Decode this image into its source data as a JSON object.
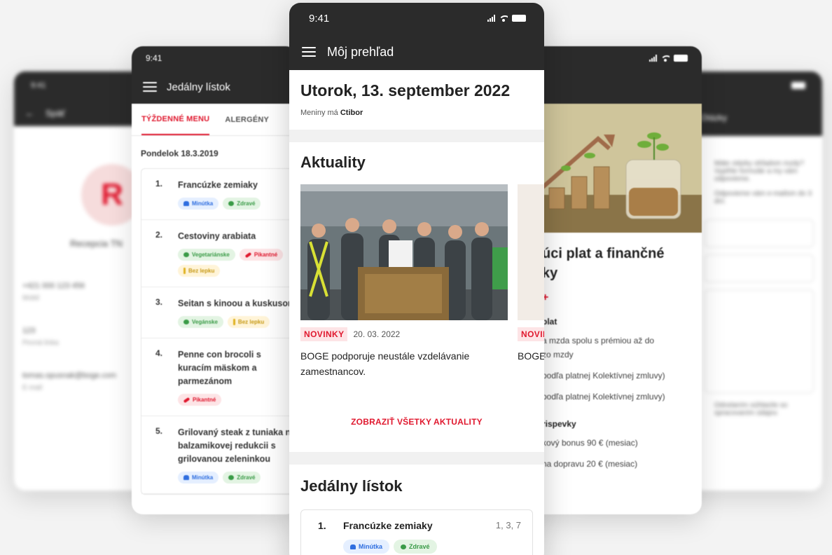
{
  "colors": {
    "accent": "#e0192f",
    "bar": "#2b2b2b"
  },
  "far_left": {
    "status_time": "9:41",
    "back_label": "Späť",
    "avatar_initial": "R",
    "name": "Recepcia TN",
    "fields": [
      {
        "value": "+421 000 123 456",
        "label": "Mobil"
      },
      {
        "value": "123",
        "label": "Pevná linka"
      },
      {
        "value": "tomas.opusnak@boge.com",
        "label": "E-mail"
      }
    ]
  },
  "far_right": {
    "appbar_title": "Otázky",
    "lines": [
      "Máte otázky ohľadom mzdy? Vyplňte formulár a my vám odpovieme.",
      "Odpovieme vám e-mailom do 3 dní."
    ],
    "footer_note": "Odoslaním súhlasíte so spracovaním údajov."
  },
  "menu_phone": {
    "status_time": "9:41",
    "title": "Jedálny lístok",
    "tabs": [
      "TÝŽDENNÉ MENU",
      "ALERGÉNY"
    ],
    "date": "Pondelok 18.3.2019",
    "items": [
      {
        "num": "1.",
        "name": "Francúzke zemiaky",
        "tags": [
          {
            "label": "Minútka",
            "type": "blue"
          },
          {
            "label": "Zdravé",
            "type": "green"
          }
        ]
      },
      {
        "num": "2.",
        "name": "Cestoviny arabiata",
        "tags": [
          {
            "label": "Vegetariánske",
            "type": "green"
          },
          {
            "label": "Pikantné",
            "type": "red"
          },
          {
            "label": "Bez lepku",
            "type": "yellow"
          }
        ]
      },
      {
        "num": "3.",
        "name": "Seitan s kinoou a kuskusom",
        "tags": [
          {
            "label": "Vegánske",
            "type": "green"
          },
          {
            "label": "Bez lepku",
            "type": "yellow"
          }
        ]
      },
      {
        "num": "4.",
        "name": "Penne con brocoli s kuracím mäskom a parmezánom",
        "tags": [
          {
            "label": "Pikantné",
            "type": "red"
          }
        ]
      },
      {
        "num": "5.",
        "name": "Grilovaný steak z tuniaka na balzamikovej redukcii s grilovanou zeleninkou",
        "tags": [
          {
            "label": "Minútka",
            "type": "blue"
          },
          {
            "label": "Zdravé",
            "type": "green"
          }
        ]
      }
    ]
  },
  "finance_phone": {
    "title_fragment": "úci plat a finančné",
    "title_fragment2": "ky",
    "plus": "+",
    "subheading1": "plat",
    "lines1": [
      "a mzda spolu s prémiou až do",
      " zo mzdy",
      "podľa platnej Kolektívnej zmluvy)",
      "podľa platnej Kolektívnej zmluvy)"
    ],
    "subheading2": "rispevky",
    "lines2": [
      "kový bonus 90 € (mesiac)",
      "na dopravu 20 € (mesiac)"
    ]
  },
  "main_phone": {
    "status_time": "9:41",
    "title": "Môj prehľad",
    "date_title": "Utorok, 13. september 2022",
    "nameday_prefix": "Meniny má ",
    "nameday_name": "Ctibor",
    "news_title": "Aktuality",
    "news": [
      {
        "badge": "NOVINKY",
        "date": "20. 03. 2022",
        "headline": "BOGE podporuje neustále vzdelávanie zamestnancov."
      },
      {
        "badge": "NOVINKY",
        "date": "",
        "headline": "BOGE štude"
      }
    ],
    "show_all": "ZOBRAZIŤ VŠETKY AKTUALITY",
    "lunch_title": "Jedálny lístok",
    "lunch_item": {
      "num": "1.",
      "name": "Francúzke zemiaky",
      "allergens": "1, 3, 7",
      "tags": [
        {
          "label": "Minútka",
          "type": "blue"
        },
        {
          "label": "Zdravé",
          "type": "green"
        }
      ]
    }
  }
}
